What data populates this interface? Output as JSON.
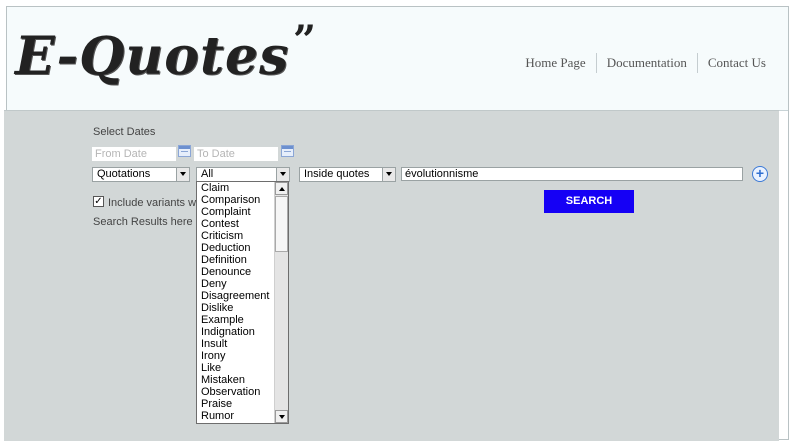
{
  "header": {
    "logo_text": "E-Quotes",
    "logo_quote_mark": "”",
    "nav": [
      "Home Page",
      "Documentation",
      "Contact Us"
    ]
  },
  "form": {
    "select_dates_label": "Select Dates",
    "from_date_placeholder": "From Date",
    "to_date_placeholder": "To Date",
    "source_select_value": "Quotations",
    "category_select_value": "All",
    "scope_select_value": "Inside quotes",
    "search_value": "évolutionnisme",
    "include_variants_label": "Include variants wi",
    "include_variants_checked": true,
    "search_button": "SEARCH",
    "results_label": "Search Results here"
  },
  "category_options": [
    "Claim",
    "Comparison",
    "Complaint",
    "Contest",
    "Criticism",
    "Deduction",
    "Definition",
    "Denounce",
    "Deny",
    "Disagreement",
    "Dislike",
    "Example",
    "Indignation",
    "Insult",
    "Irony",
    "Like",
    "Mistaken",
    "Observation",
    "Praise",
    "Rumor"
  ],
  "colors": {
    "search_button": "#1500f5",
    "content_bg": "#d2d7d7",
    "header_bg": "#f6fbfc"
  },
  "icons": {
    "calendar": "calendar-icon",
    "add": "plus-circle-icon"
  }
}
